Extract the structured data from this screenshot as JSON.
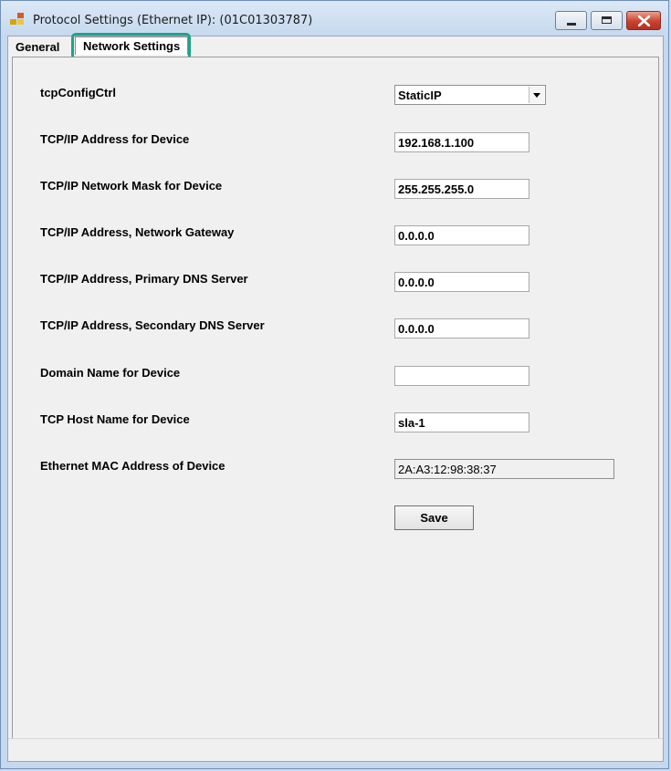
{
  "window": {
    "title": "Protocol Settings (Ethernet IP): (01C01303787)"
  },
  "tabs": [
    {
      "label": "General",
      "active": false
    },
    {
      "label": "Network Settings",
      "active": true
    }
  ],
  "form": {
    "tcp_config": {
      "label": "tcpConfigCtrl",
      "value": "StaticIP"
    },
    "ip_address": {
      "label": "TCP/IP Address for Device",
      "value": "192.168.1.100"
    },
    "network_mask": {
      "label": "TCP/IP Network Mask for Device",
      "value": "255.255.255.0"
    },
    "gateway": {
      "label": "TCP/IP Address, Network Gateway",
      "value": "0.0.0.0"
    },
    "primary_dns": {
      "label": "TCP/IP Address, Primary DNS Server",
      "value": "0.0.0.0"
    },
    "secondary_dns": {
      "label": "TCP/IP Address, Secondary DNS Server",
      "value": "0.0.0.0"
    },
    "domain_name": {
      "label": "Domain Name for Device",
      "value": ""
    },
    "host_name": {
      "label": "TCP Host Name for Device",
      "value": "sla-1"
    },
    "mac_address": {
      "label": "Ethernet MAC Address of Device",
      "value": "2A:A3:12:98:38:37"
    }
  },
  "buttons": {
    "save_label": "Save"
  },
  "colors": {
    "highlight": "#1fa38a",
    "close_button": "#c8432f"
  }
}
